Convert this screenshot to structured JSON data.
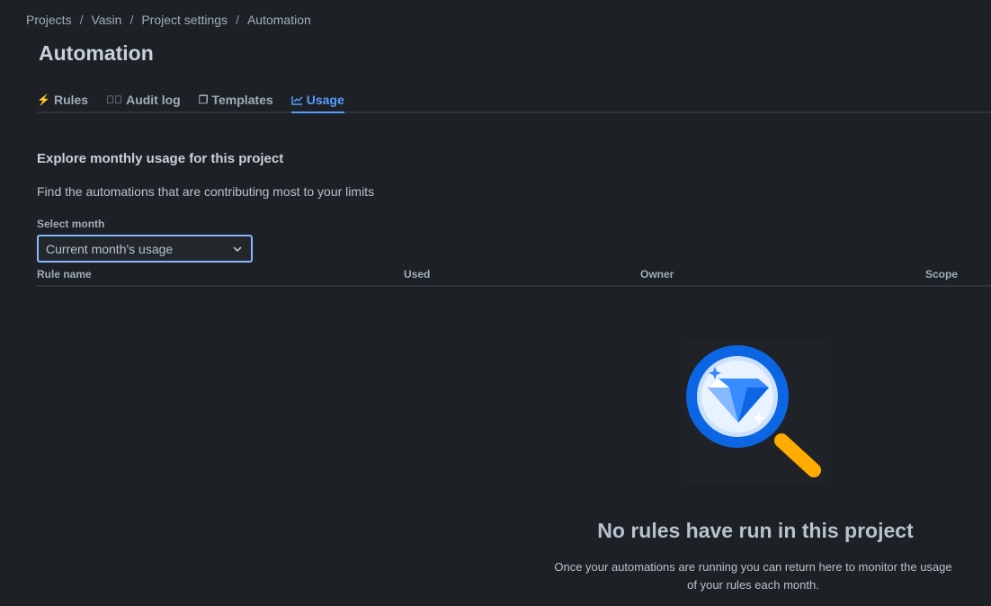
{
  "breadcrumb": [
    "Projects",
    "Vasin",
    "Project settings",
    "Automation"
  ],
  "title": "Automation",
  "tabs": [
    {
      "label": "Rules",
      "icon": "lightning-icon"
    },
    {
      "label": "Audit log",
      "icon": "check-circle-icon"
    },
    {
      "label": "Templates",
      "icon": "copy-icon"
    },
    {
      "label": "Usage",
      "icon": "chart-line-icon"
    }
  ],
  "section": {
    "heading": "Explore monthly usage for this project",
    "description": "Find the automations that are contributing most to your limits",
    "select_label": "Select month",
    "select_value": "Current month's usage"
  },
  "table": {
    "columns": [
      "Rule name",
      "Used",
      "Owner",
      "Scope"
    ]
  },
  "empty": {
    "title": "No rules have run in this project",
    "description": "Once your automations are running you can return here to monitor the usage of your rules each month."
  },
  "colors": {
    "accent": "#579dff",
    "background": "#1d2125"
  }
}
